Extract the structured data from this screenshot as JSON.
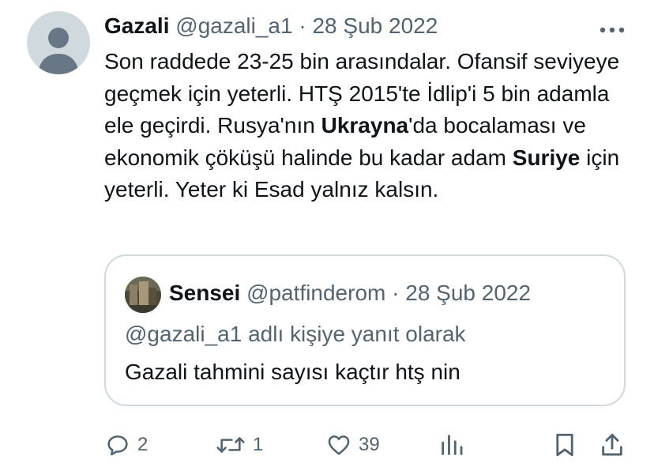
{
  "tweet": {
    "author_name": "Gazali",
    "handle": "@gazali_a1",
    "separator": "·",
    "date": "28 Şub 2022",
    "text_parts": [
      "Son raddede 23-25 bin arasındalar. Ofansif seviyeye geçmek için yeterli. HTŞ 2015'te İdlip'i 5 bin adamla ele geçirdi. Rusya'nın ",
      "Ukrayna",
      "'da bocalaması ve ekonomik çöküşü halinde bu kadar adam ",
      "Suriye",
      " için yeterli. Yeter ki Esad yalnız kalsın."
    ],
    "more_icon": "more-horizontal-icon"
  },
  "quote": {
    "author_name": "Sensei",
    "handle": "@patfinderom",
    "separator": "·",
    "date": "28 Şub 2022",
    "reply_context": "@gazali_a1 adlı kişiye yanıt olarak",
    "text": "Gazali tahmini sayısı kaçtır htş nin"
  },
  "actions": {
    "reply": {
      "icon": "reply-icon",
      "count": "2"
    },
    "retweet": {
      "icon": "retweet-icon",
      "count": "1"
    },
    "like": {
      "icon": "heart-icon",
      "count": "39"
    },
    "views": {
      "icon": "views-chart-icon"
    },
    "bookmark": {
      "icon": "bookmark-icon"
    },
    "share": {
      "icon": "share-icon"
    }
  },
  "colors": {
    "text": "#0f1419",
    "muted": "#536471",
    "border": "#cfd9de",
    "avatar_placeholder": "#cfd9de"
  }
}
